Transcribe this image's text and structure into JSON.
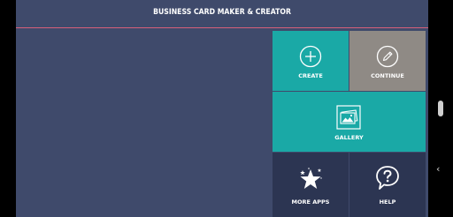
{
  "app": {
    "title": "BUSINESS CARD MAKER & CREATOR",
    "accent_line_color": "#d9607a",
    "background_color": "#3f4a6b"
  },
  "menu": {
    "create": {
      "label": "CREATE",
      "icon": "plus-circle-icon",
      "color": "#1aa9a6"
    },
    "continue": {
      "label": "CONTINUE",
      "icon": "pencil-circle-icon",
      "color": "#8f8a85"
    },
    "gallery": {
      "label": "GALLERY",
      "icon": "gallery-image-icon",
      "color": "#1aa9a6"
    },
    "more_apps": {
      "label": "MORE APPS",
      "icon": "star-icon",
      "color": "#2c3552"
    },
    "help": {
      "label": "HELP",
      "icon": "help-bubble-icon",
      "color": "#2c3552"
    }
  },
  "system_nav": {
    "back_glyph": "‹"
  }
}
